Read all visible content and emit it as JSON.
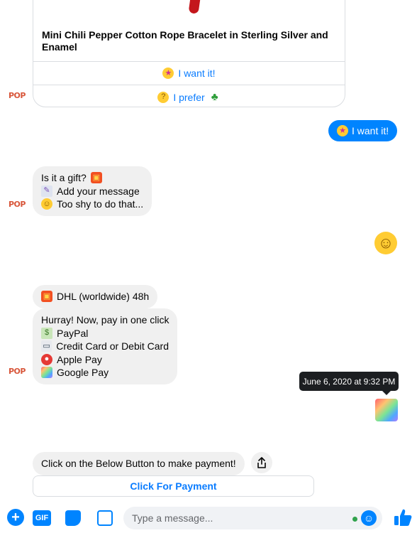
{
  "product_card": {
    "title": "Mini Chili Pepper Cotton Rope Bracelet in Sterling Silver and Enamel",
    "buttons": [
      {
        "label": "I want it!",
        "icon": "star-struck-emoji-icon"
      },
      {
        "label": "I prefer",
        "icon": "thinking-emoji-icon",
        "trailing_icon": "four-leaf-clover-icon"
      }
    ]
  },
  "avatar": {
    "label": "POP"
  },
  "messages": {
    "out_want_it": "I want it!",
    "gift_question": [
      {
        "icon": "gift-icon",
        "text": "Is it a gift?",
        "icon_after": true
      },
      {
        "icon": "memo-icon",
        "text": "Add your message"
      },
      {
        "icon": "smile-emoji-icon",
        "text": "Too shy to do that..."
      }
    ],
    "shipping": {
      "icon": "gift-icon",
      "text": "DHL (worldwide) 48h"
    },
    "payment_options": {
      "intro": "Hurray! Now, pay in one click",
      "items": [
        {
          "icon": "money-icon",
          "text": "PayPal"
        },
        {
          "icon": "credit-card-icon",
          "text": "Credit Card or Debit Card"
        },
        {
          "icon": "apple-icon",
          "text": "Apple Pay"
        },
        {
          "icon": "rainbow-icon",
          "text": "Google Pay"
        }
      ]
    },
    "timestamp_tooltip": "June 6, 2020 at 9:32 PM",
    "payment_prompt": "Click on the Below Button to make payment!",
    "payment_button": "Click For Payment"
  },
  "composer": {
    "placeholder": "Type a message...",
    "gif_label": "GIF",
    "plus_label": "+"
  },
  "colors": {
    "accent": "#0084ff",
    "link": "#0a7cff",
    "bubble_in": "#f0f0f0",
    "tooltip": "#1c1e21"
  }
}
